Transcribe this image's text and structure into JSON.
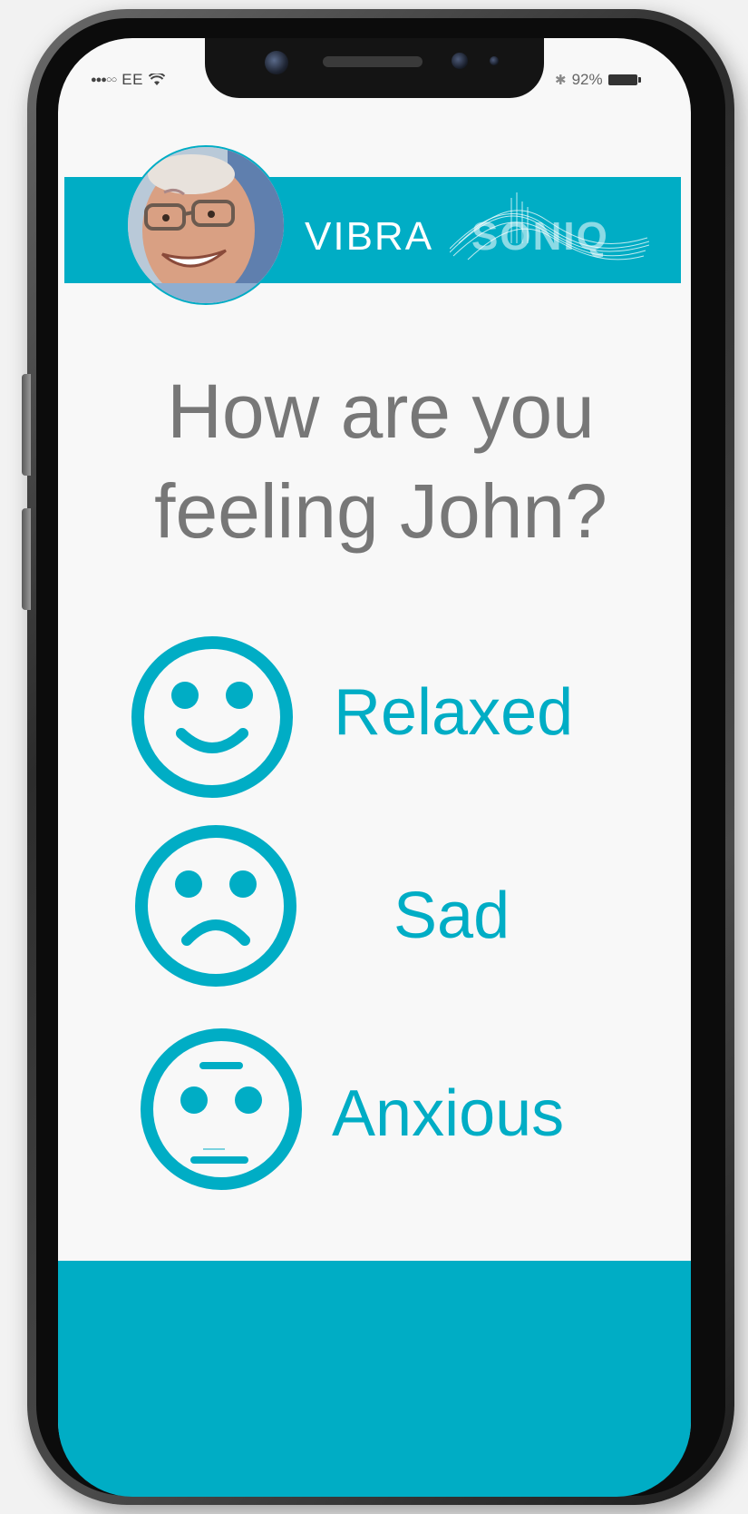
{
  "status_bar": {
    "carrier": "EE",
    "signal_dots": "●●●○○",
    "bluetooth": "✱",
    "battery_percent": "92%"
  },
  "header": {
    "logo_part_1": "VIBRA",
    "logo_part_2": "SONIQ",
    "avatar_alt": "John profile photo"
  },
  "question": {
    "line_1": "How are you",
    "line_2": "feeling John?"
  },
  "moods": [
    {
      "label": "Relaxed",
      "icon": "happy-face-icon"
    },
    {
      "label": "Sad",
      "icon": "sad-face-icon"
    },
    {
      "label": "Anxious",
      "icon": "anxious-face-icon"
    }
  ],
  "colors": {
    "accent": "#00adc5",
    "question_text": "#777777",
    "screen_bg": "#f8f8f8"
  }
}
